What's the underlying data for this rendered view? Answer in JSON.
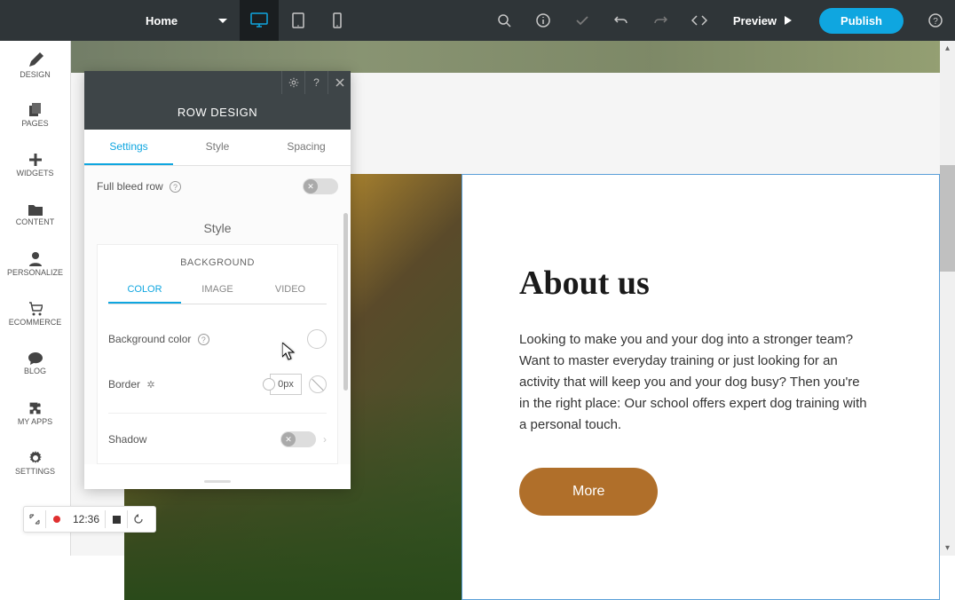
{
  "topbar": {
    "page_label": "Home",
    "device_active": "desktop",
    "preview_label": "Preview",
    "publish_label": "Publish"
  },
  "sidebar": {
    "items": [
      {
        "label": "DESIGN",
        "icon": "pencil-icon"
      },
      {
        "label": "PAGES",
        "icon": "pages-icon"
      },
      {
        "label": "WIDGETS",
        "icon": "plus-icon"
      },
      {
        "label": "CONTENT",
        "icon": "folder-icon"
      },
      {
        "label": "PERSONALIZE",
        "icon": "person-icon"
      },
      {
        "label": "ECOMMERCE",
        "icon": "cart-icon"
      },
      {
        "label": "BLOG",
        "icon": "chat-icon"
      },
      {
        "label": "MY APPS",
        "icon": "puzzle-icon"
      },
      {
        "label": "SETTINGS",
        "icon": "gear-icon"
      }
    ]
  },
  "panel": {
    "title": "ROW DESIGN",
    "tabs": {
      "settings": "Settings",
      "style": "Style",
      "spacing": "Spacing"
    },
    "active_tab": "Settings",
    "full_bleed_label": "Full bleed row",
    "full_bleed_on": false,
    "style_heading": "Style",
    "background_heading": "BACKGROUND",
    "bg_tabs": {
      "color": "COLOR",
      "image": "IMAGE",
      "video": "VIDEO"
    },
    "bg_active_tab": "COLOR",
    "bg_color_label": "Background color",
    "bg_color_value": "#ffffff",
    "border_label": "Border",
    "border_value": "0px",
    "shadow_label": "Shadow",
    "shadow_on": false
  },
  "content": {
    "heading": "About us",
    "paragraph": "Looking to make you and your dog into a stronger team? Want to master everyday training or just looking for an activity that will keep you and your dog busy? Then you're in the right place: Our school offers expert dog training with a personal touch.",
    "button_label": "More"
  },
  "recorder": {
    "time": "12:36"
  }
}
